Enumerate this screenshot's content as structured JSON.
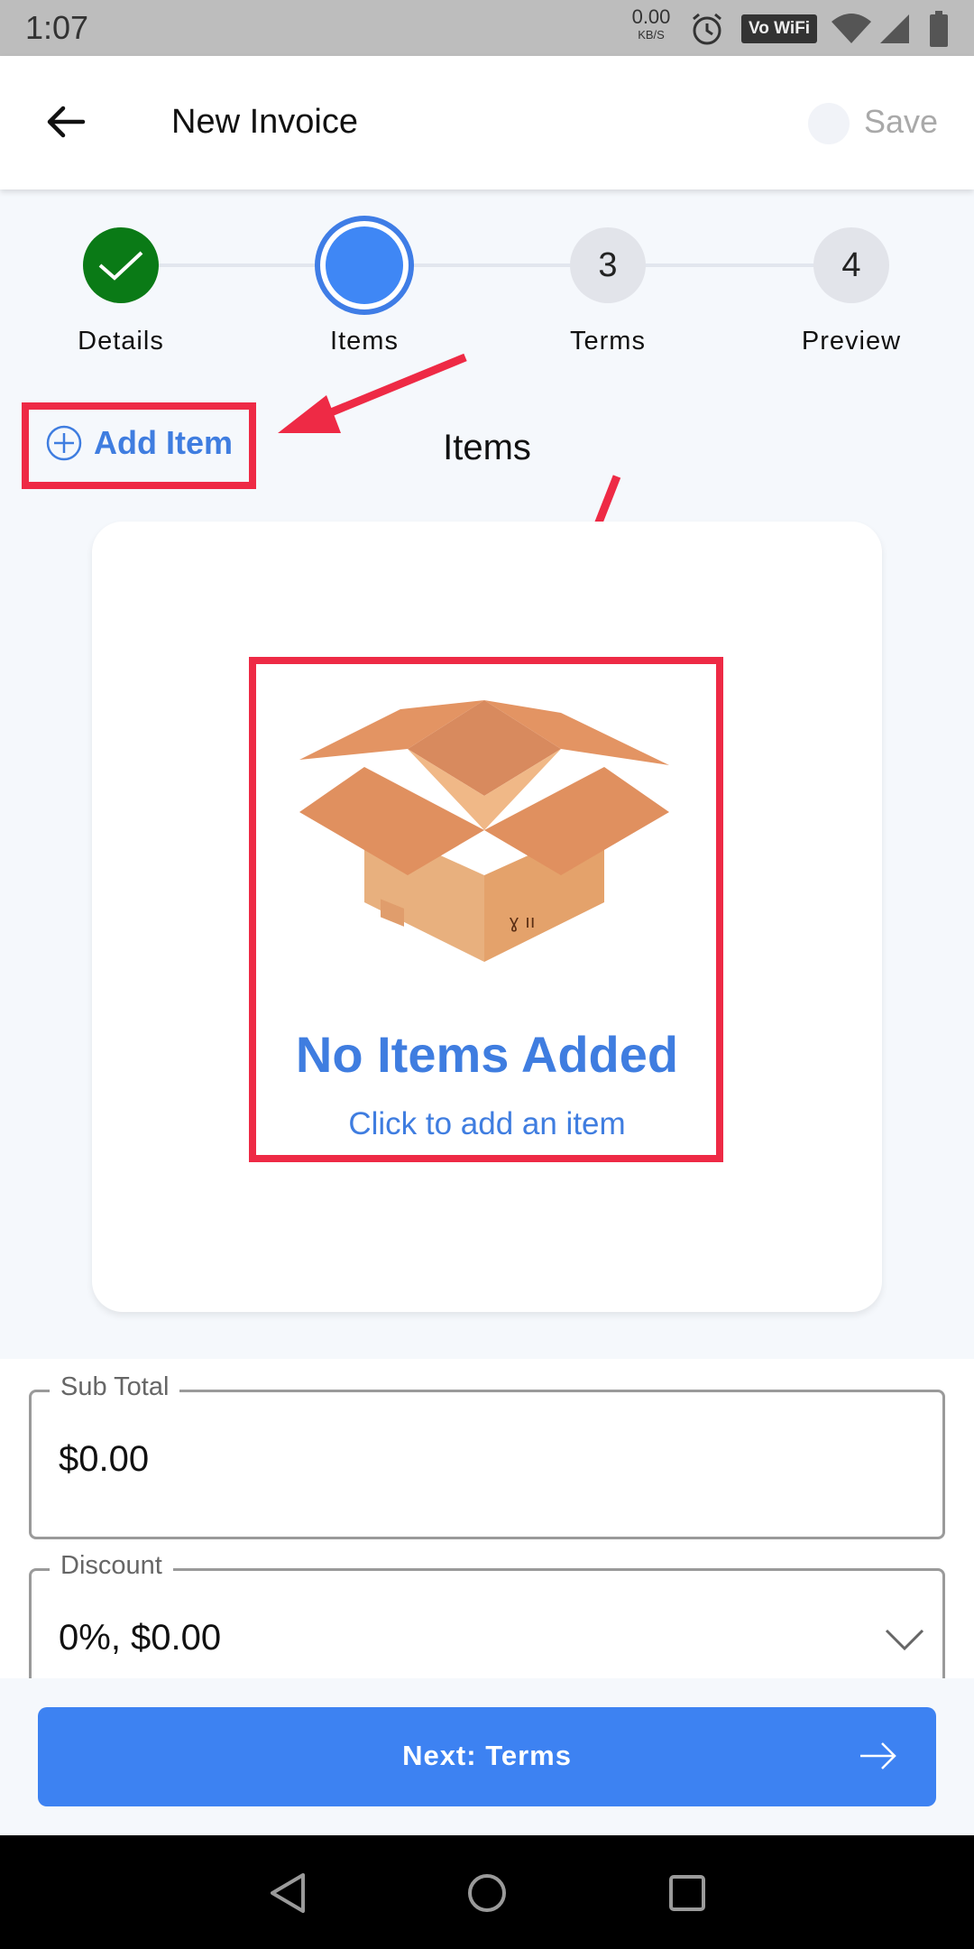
{
  "status_bar": {
    "time": "1:07",
    "net_speed_value": "0.00",
    "net_speed_unit": "KB/S",
    "volte_wifi": "Vo WiFi"
  },
  "app_bar": {
    "title": "New Invoice",
    "save_label": "Save"
  },
  "stepper": {
    "steps": [
      {
        "label": "Details",
        "number": "",
        "state": "done"
      },
      {
        "label": "Items",
        "number": "",
        "state": "active"
      },
      {
        "label": "Terms",
        "number": "3",
        "state": "todo"
      },
      {
        "label": "Preview",
        "number": "4",
        "state": "todo"
      }
    ]
  },
  "items_section": {
    "add_item_label": "Add Item",
    "title": "Items",
    "empty_title": "No Items Added",
    "empty_subtitle": "Click to add an item"
  },
  "totals": {
    "subtotal_label": "Sub Total",
    "subtotal_value": "$0.00",
    "discount_label": "Discount",
    "discount_value": "0%, $0.00"
  },
  "footer": {
    "next_label": "Next: Terms"
  },
  "colors": {
    "accent": "#3d82f2",
    "done_green": "#0a7a16",
    "annotation_red": "#ee2a45",
    "box_orange": "#e39463"
  }
}
